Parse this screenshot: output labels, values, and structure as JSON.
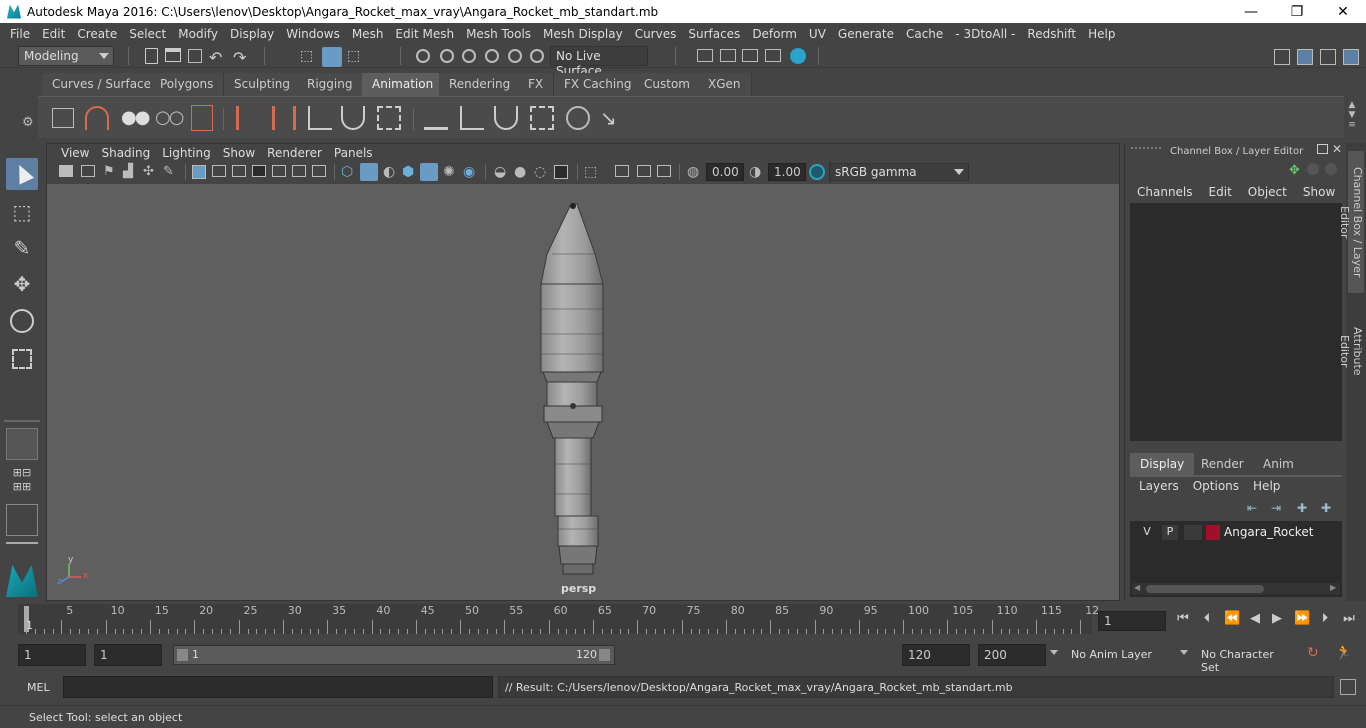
{
  "window": {
    "title": "Autodesk Maya 2016: C:\\Users\\lenov\\Desktop\\Angara_Rocket_max_vray\\Angara_Rocket_mb_standart.mb",
    "minimize": "—",
    "maximize": "❐",
    "close": "✕"
  },
  "menubar": [
    "File",
    "Edit",
    "Create",
    "Select",
    "Modify",
    "Display",
    "Windows",
    "Mesh",
    "Edit Mesh",
    "Mesh Tools",
    "Mesh Display",
    "Curves",
    "Surfaces",
    "Deform",
    "UV",
    "Generate",
    "Cache",
    "- 3DtoAll -",
    "Redshift",
    "Help"
  ],
  "statusline": {
    "mode": "Modeling",
    "live_surface": "No Live Surface"
  },
  "shelf_tabs": [
    "Curves / Surfaces",
    "Polygons",
    "Sculpting",
    "Rigging",
    "Animation",
    "Rendering",
    "FX",
    "FX Caching",
    "Custom",
    "XGen"
  ],
  "active_shelf_tab": "Animation",
  "viewport": {
    "menus": [
      "View",
      "Shading",
      "Lighting",
      "Show",
      "Renderer",
      "Panels"
    ],
    "exposure": "0.00",
    "gamma": "1.00",
    "color_space": "sRGB gamma",
    "camera_label": "persp",
    "axis_y": "y",
    "axis_x": "x",
    "axis_z": "z"
  },
  "channel_box": {
    "title": "Channel Box / Layer Editor",
    "menus": [
      "Channels",
      "Edit",
      "Object",
      "Show"
    ],
    "layer_tabs": [
      "Display",
      "Render",
      "Anim"
    ],
    "active_layer_tab": "Display",
    "layer_menus": [
      "Layers",
      "Options",
      "Help"
    ],
    "layer": {
      "v": "V",
      "p": "P",
      "name": "Angara_Rocket",
      "color": "#a0102a"
    }
  },
  "side_tabs": [
    "Channel Box / Layer Editor",
    "Attribute Editor"
  ],
  "timeline": {
    "ticks": [
      "1",
      "5",
      "10",
      "15",
      "20",
      "25",
      "30",
      "35",
      "40",
      "45",
      "50",
      "55",
      "60",
      "65",
      "70",
      "75",
      "80",
      "85",
      "90",
      "95",
      "100",
      "105",
      "110",
      "115",
      "12"
    ],
    "current_frame": "1"
  },
  "range": {
    "start": "1",
    "playback_start": "1",
    "slider_start": "1",
    "slider_end": "120",
    "playback_end": "120",
    "end": "200",
    "anim_layer": "No Anim Layer",
    "character_set": "No Character Set"
  },
  "command": {
    "label": "MEL",
    "result": "// Result: C:/Users/lenov/Desktop/Angara_Rocket_max_vray/Angara_Rocket_mb_standart.mb"
  },
  "help_line": "Select Tool: select an object",
  "colors": {
    "accent": "#5d7fa3",
    "background": "#444444",
    "viewport": "#5f5f5f"
  }
}
